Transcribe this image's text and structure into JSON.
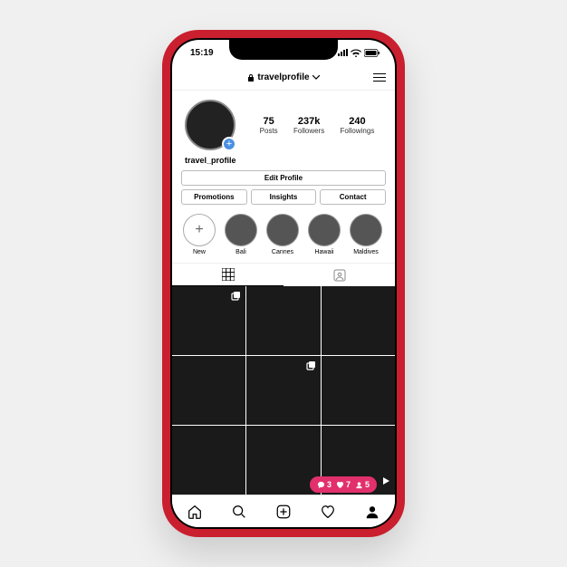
{
  "status": {
    "time": "15:19"
  },
  "header": {
    "title": "travelprofile"
  },
  "profile": {
    "username": "travel_profile",
    "stats": {
      "posts": {
        "value": "75",
        "label": "Posts"
      },
      "followers": {
        "value": "237k",
        "label": "Followers"
      },
      "followings": {
        "value": "240",
        "label": "Followings"
      }
    }
  },
  "buttons": {
    "edit": "Edit Profile",
    "promotions": "Promotions",
    "insights": "Insights",
    "contact": "Contact"
  },
  "highlights": [
    {
      "label": "New",
      "type": "new"
    },
    {
      "label": "Bali",
      "type": "story"
    },
    {
      "label": "Cannes",
      "type": "story"
    },
    {
      "label": "Hawaii",
      "type": "story"
    },
    {
      "label": "Maldives",
      "type": "story"
    }
  ],
  "grid": [
    {
      "badge": "multi"
    },
    {
      "badge": null
    },
    {
      "badge": null
    },
    {
      "badge": null
    },
    {
      "badge": "multi"
    },
    {
      "badge": null
    },
    {
      "badge": null
    },
    {
      "badge": null
    },
    {
      "badge": "video"
    }
  ],
  "notifications": {
    "comments": "3",
    "likes": "7",
    "followers": "5"
  }
}
